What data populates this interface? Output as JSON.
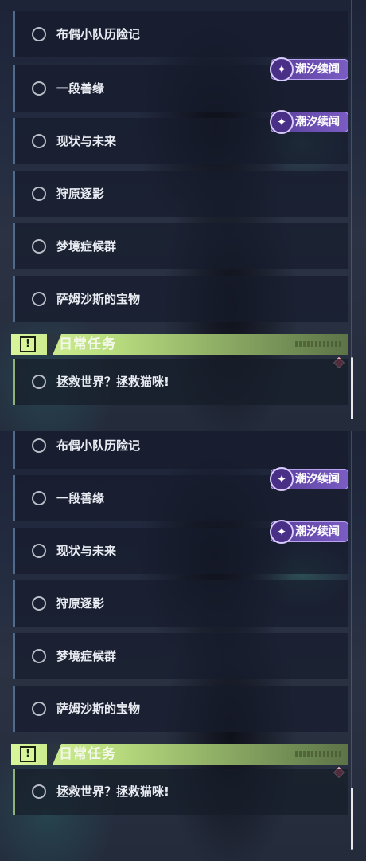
{
  "quests": [
    {
      "label": "布偶小队历险记"
    },
    {
      "label": "一段善缘"
    },
    {
      "label": "现状与未来"
    },
    {
      "label": "狩原逐影"
    },
    {
      "label": "梦境症候群"
    },
    {
      "label": "萨姆沙斯的宝物"
    }
  ],
  "event_badge": {
    "text": "潮汐续闻"
  },
  "daily_section": {
    "title": "日常任务",
    "icon": "exclamation-icon",
    "quest": {
      "label": "拯救世界？拯救猫咪!"
    }
  },
  "colors": {
    "daily_header": "#d8f59a",
    "badge": "#6a4cb0",
    "alert_diamond": "#d9536c"
  }
}
